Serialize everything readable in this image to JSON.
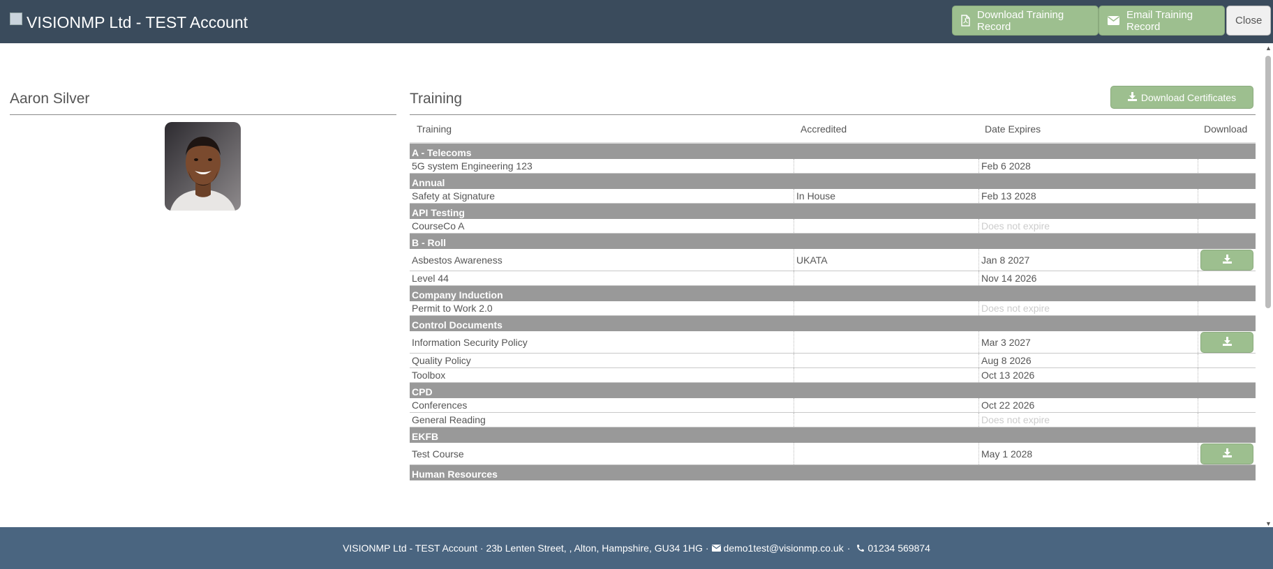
{
  "header": {
    "title": "VISIONMP Ltd - TEST Account",
    "download_record_label": "Download Training Record",
    "email_record_label": "Email Training Record",
    "close_label": "Close"
  },
  "person": {
    "name": "Aaron Silver"
  },
  "training": {
    "title": "Training",
    "download_certificates_label": "Download Certificates",
    "columns": [
      "Training",
      "Accredited",
      "Date Expires",
      "Download"
    ],
    "rows": [
      {
        "type": "group",
        "label": "A - Telecoms"
      },
      {
        "type": "item",
        "name": "5G system Engineering 123",
        "accredited": "",
        "expires": "Feb 6 2028",
        "muted": false,
        "download": false
      },
      {
        "type": "group",
        "label": "Annual"
      },
      {
        "type": "item",
        "name": "Safety at Signature",
        "accredited": "In House",
        "expires": "Feb 13 2028",
        "muted": false,
        "download": false
      },
      {
        "type": "group",
        "label": "API Testing"
      },
      {
        "type": "item",
        "name": "CourseCo A",
        "accredited": "",
        "expires": "Does not expire",
        "muted": true,
        "download": false
      },
      {
        "type": "group",
        "label": "B - Roll"
      },
      {
        "type": "item",
        "name": "Asbestos Awareness",
        "accredited": "UKATA",
        "expires": "Jan 8 2027",
        "muted": false,
        "download": true
      },
      {
        "type": "item",
        "name": "Level 44",
        "accredited": "",
        "expires": "Nov 14 2026",
        "muted": false,
        "download": false
      },
      {
        "type": "group",
        "label": "Company Induction"
      },
      {
        "type": "item",
        "name": "Permit to Work 2.0",
        "accredited": "",
        "expires": "Does not expire",
        "muted": true,
        "download": false
      },
      {
        "type": "group",
        "label": "Control Documents"
      },
      {
        "type": "item",
        "name": "Information Security Policy",
        "accredited": "",
        "expires": "Mar 3 2027",
        "muted": false,
        "download": true
      },
      {
        "type": "item",
        "name": "Quality Policy",
        "accredited": "",
        "expires": "Aug 8 2026",
        "muted": false,
        "download": false
      },
      {
        "type": "item",
        "name": "Toolbox",
        "accredited": "",
        "expires": "Oct 13 2026",
        "muted": false,
        "download": false
      },
      {
        "type": "group",
        "label": "CPD"
      },
      {
        "type": "item",
        "name": "Conferences",
        "accredited": "",
        "expires": "Oct 22 2026",
        "muted": false,
        "download": false
      },
      {
        "type": "item",
        "name": "General Reading",
        "accredited": "",
        "expires": "Does not expire",
        "muted": true,
        "download": false
      },
      {
        "type": "group",
        "label": "EKFB"
      },
      {
        "type": "item",
        "name": "Test Course",
        "accredited": "",
        "expires": "May 1 2028",
        "muted": false,
        "download": true
      },
      {
        "type": "group",
        "label": "Human Resources"
      }
    ]
  },
  "footer": {
    "address": "VISIONMP Ltd - TEST Account · 23b Lenten Street, , Alton, Hampshire, GU34 1HG ·",
    "email": "demo1test@visionmp.co.uk",
    "separator": "·",
    "phone": "01234 569874"
  },
  "colors": {
    "header_bg": "#3a4b5c",
    "footer_bg": "#4a6580",
    "button_green": "#9dbf8f",
    "group_row": "#999999"
  },
  "icons": [
    "file-pdf-icon",
    "envelope-icon",
    "download-icon",
    "phone-icon"
  ]
}
